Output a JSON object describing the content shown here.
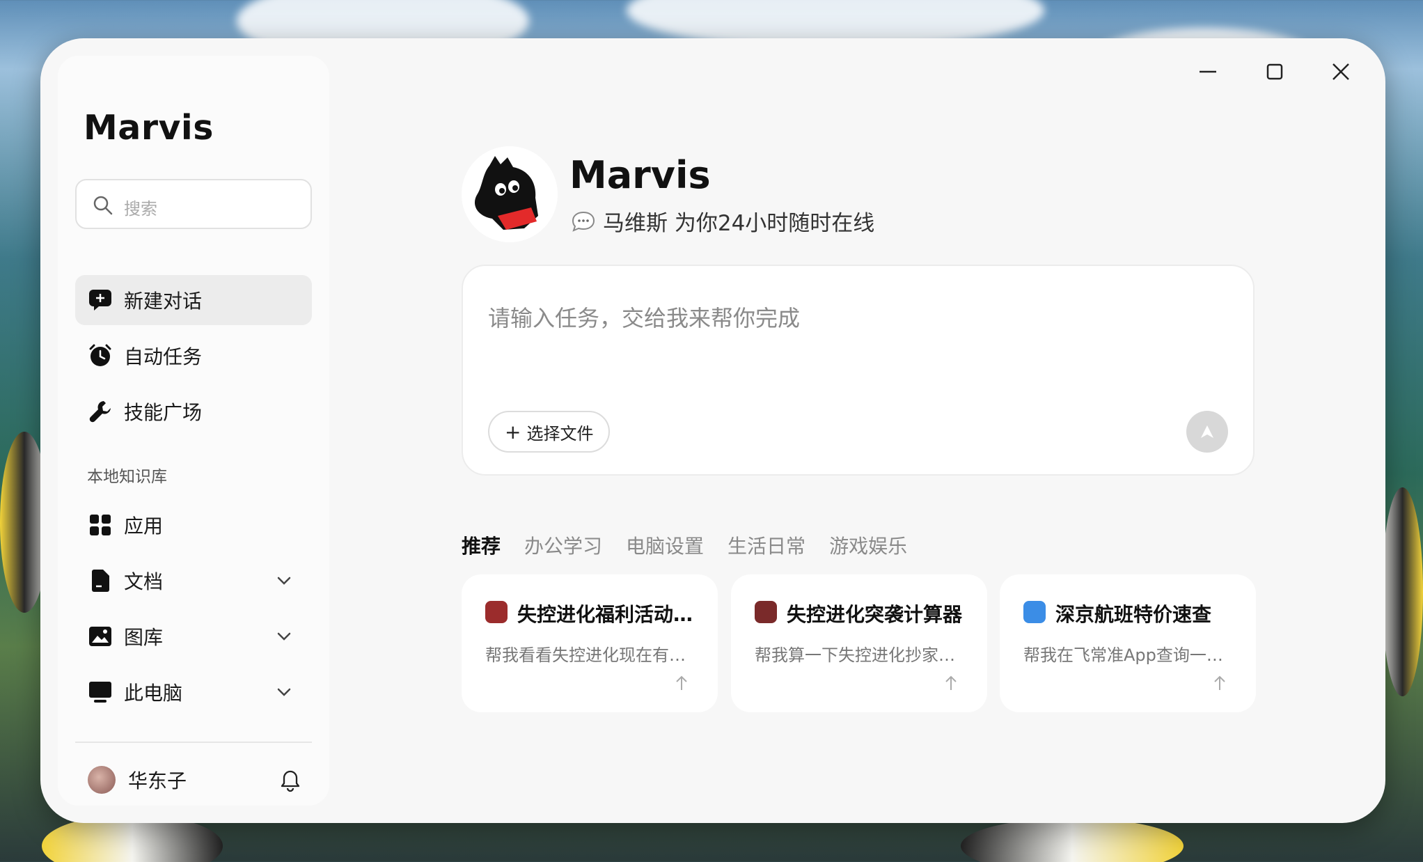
{
  "app": {
    "title": "Marvis"
  },
  "search": {
    "placeholder": "搜索"
  },
  "nav": [
    {
      "label": "新建对话",
      "icon": "new-chat-icon"
    },
    {
      "label": "自动任务",
      "icon": "alarm-clock-icon"
    },
    {
      "label": "技能广场",
      "icon": "wrench-icon"
    }
  ],
  "knowledge": {
    "section_label": "本地知识库",
    "items": [
      {
        "label": "应用",
        "icon": "apps-grid-icon"
      },
      {
        "label": "文档",
        "icon": "document-icon"
      },
      {
        "label": "图库",
        "icon": "gallery-icon"
      },
      {
        "label": "此电脑",
        "icon": "computer-icon"
      }
    ]
  },
  "user": {
    "name": "华东子"
  },
  "hero": {
    "title": "Marvis",
    "subtitle": "马维斯 为你24小时随时在线"
  },
  "input": {
    "placeholder": "请输入任务，交给我来帮你完成",
    "file_button": "选择文件"
  },
  "tabs": [
    "推荐",
    "办公学习",
    "电脑设置",
    "生活日常",
    "游戏娱乐"
  ],
  "cards": [
    {
      "title": "失控进化福利活动…",
      "desc": "帮我看看失控进化现在有…",
      "icon_color": "#9b2c2c"
    },
    {
      "title": "失控进化突袭计算器",
      "desc": "帮我算一下失控进化抄家…",
      "icon_color": "#7a2a2a"
    },
    {
      "title": "深京航班特价速查",
      "desc": "帮我在飞常准App查询一…",
      "icon_color": "#3b8de6"
    }
  ],
  "colors": {
    "accent": "#111111",
    "window_bg": "#f7f7f7",
    "mascot_red": "#e32a2a"
  }
}
